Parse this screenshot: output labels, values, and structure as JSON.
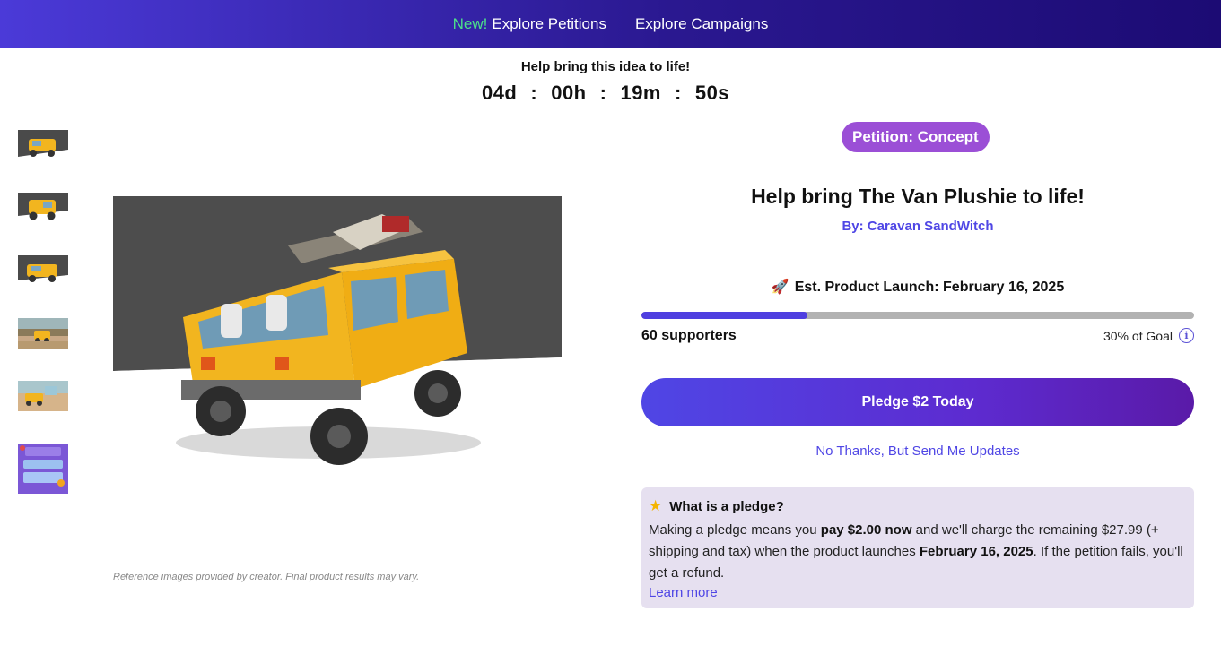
{
  "nav": {
    "new_label": "New!",
    "explore_petitions": "Explore Petitions",
    "explore_campaigns": "Explore Campaigns"
  },
  "countdown": {
    "title": "Help bring this idea to life!",
    "days": "04d",
    "hours": "00h",
    "minutes": "19m",
    "seconds": "50s",
    "separator": ":"
  },
  "gallery": {
    "thumbnail_count": 6,
    "disclaimer": "Reference images provided by creator. Final product results may vary."
  },
  "product": {
    "badge": "Petition: Concept",
    "title": "Help bring The Van Plushie to life!",
    "by_prefix": "By:",
    "creator": "Caravan SandWitch",
    "launch_label": "Est. Product Launch: February 16, 2025",
    "progress_fraction": 0.3,
    "supporters": "60 supporters",
    "goal_text": "30% of Goal",
    "pledge_button": "Pledge $2 Today",
    "no_thanks": "No Thanks, But Send Me Updates"
  },
  "pledge_info": {
    "heading": "What is a pledge?",
    "text_1": "Making a pledge means you ",
    "bold_1": "pay $2.00 now",
    "text_2": " and we'll charge the remaining $27.99 (+ shipping and tax) when the product launches ",
    "bold_2": "February 16, 2025",
    "text_3": ". If the petition fails, you'll get a refund.",
    "learn_more": "Learn more"
  },
  "colors": {
    "accent": "#4f46e5",
    "badge": "#9b4fd6",
    "new_tag": "#4ce08a",
    "info_bg": "#e6e0f0",
    "van_yellow": "#f2b51f"
  },
  "icons": [
    "rocket-icon",
    "info-icon",
    "star-icon"
  ]
}
